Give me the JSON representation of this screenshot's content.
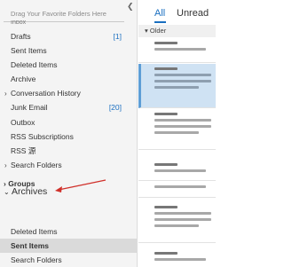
{
  "folder_pane": {
    "drag_hint": "Drag Your Favorite Folders Here",
    "clipped_label": "Inbox",
    "collapse_icon": "chevron-left-icon",
    "folders": [
      {
        "label": "Drafts",
        "count": "[1]"
      },
      {
        "label": "Sent Items",
        "count": ""
      },
      {
        "label": "Deleted Items",
        "count": ""
      },
      {
        "label": "Archive",
        "count": ""
      },
      {
        "label": "Conversation History",
        "count": "",
        "expander": true
      },
      {
        "label": "Junk Email",
        "count": "[20]"
      },
      {
        "label": "Outbox",
        "count": ""
      },
      {
        "label": "RSS Subscriptions",
        "count": ""
      },
      {
        "label": "RSS 源",
        "count": ""
      },
      {
        "label": "Search Folders",
        "count": "",
        "expander": true
      }
    ],
    "groups_label": "Groups",
    "archives": {
      "label": "Archives",
      "items": [
        {
          "label": "Deleted Items"
        },
        {
          "label": "Sent Items",
          "selected": true
        },
        {
          "label": "Search Folders"
        }
      ]
    }
  },
  "mail_pane": {
    "tab_all": "All",
    "tab_unread": "Unread",
    "group_header": "Older",
    "accent_color": "#1a6fc0",
    "selected_highlight_color": "#cfe2f3"
  },
  "annotation": {
    "arrow_color": "#d0302a"
  }
}
